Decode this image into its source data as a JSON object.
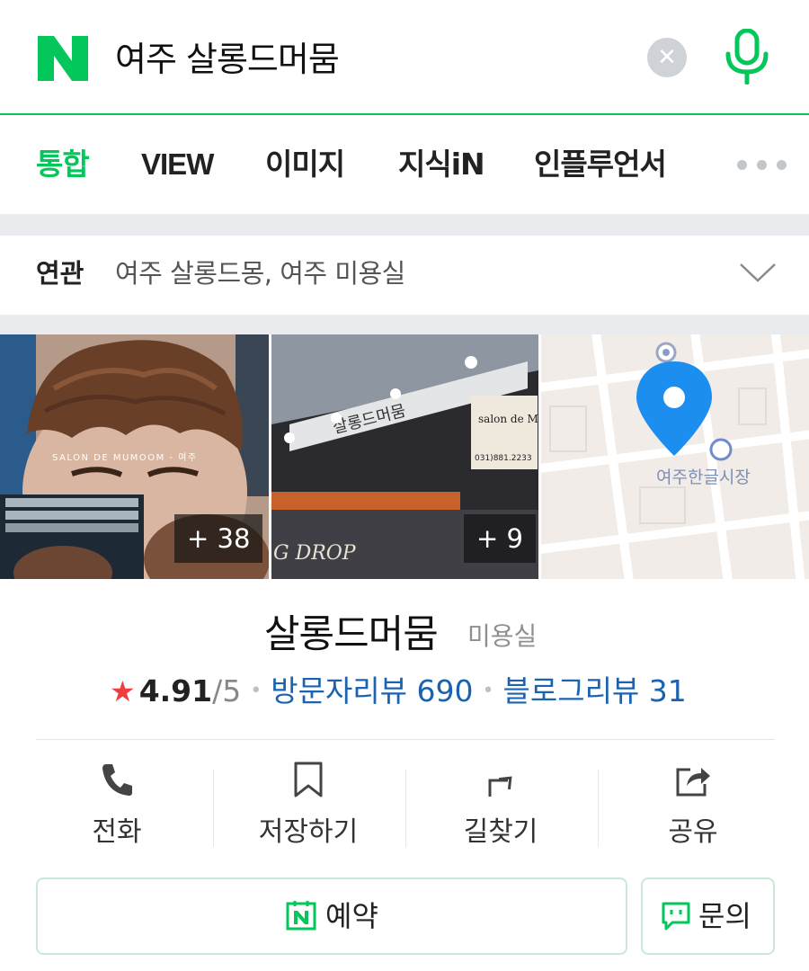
{
  "search": {
    "query": "여주 살롱드머뭄",
    "clear_icon": "close-icon",
    "mic_icon": "microphone-icon",
    "brand_color": "#03c75a"
  },
  "tabs": [
    {
      "label": "통합",
      "active": true
    },
    {
      "label": "VIEW",
      "active": false
    },
    {
      "label": "이미지",
      "active": false
    },
    {
      "label": "지식iN",
      "active": false
    },
    {
      "label": "인플루언서",
      "active": false
    }
  ],
  "related": {
    "label": "연관",
    "text": "여주 살롱드몽, 여주 미용실"
  },
  "photos": {
    "photo1_caption": "SALON DE MUMOOM - 여주",
    "photo1_count": "+ 38",
    "photo2_sign": "살롱드머뭄",
    "photo2_board": "salon de MU MOOM",
    "photo2_phone": "031)881.2233",
    "photo2_store": "G DROP",
    "photo2_count": "+ 9",
    "map_label": "여주한글시장"
  },
  "place": {
    "name": "살롱드머뭄",
    "category": "미용실",
    "rating": "4.91",
    "rating_max": "/5",
    "visitor_reviews": "방문자리뷰 690",
    "blog_reviews": "블로그리뷰 31",
    "star_color": "#ef3e3e",
    "link_color": "#1b62b0"
  },
  "actions": [
    {
      "label": "전화",
      "icon": "phone-icon"
    },
    {
      "label": "저장하기",
      "icon": "bookmark-icon"
    },
    {
      "label": "길찾기",
      "icon": "directions-icon"
    },
    {
      "label": "공유",
      "icon": "share-icon"
    }
  ],
  "buttons": {
    "book_label": "예약",
    "book_icon": "naver-booking-icon",
    "ask_label": "문의",
    "ask_icon": "chat-icon"
  }
}
